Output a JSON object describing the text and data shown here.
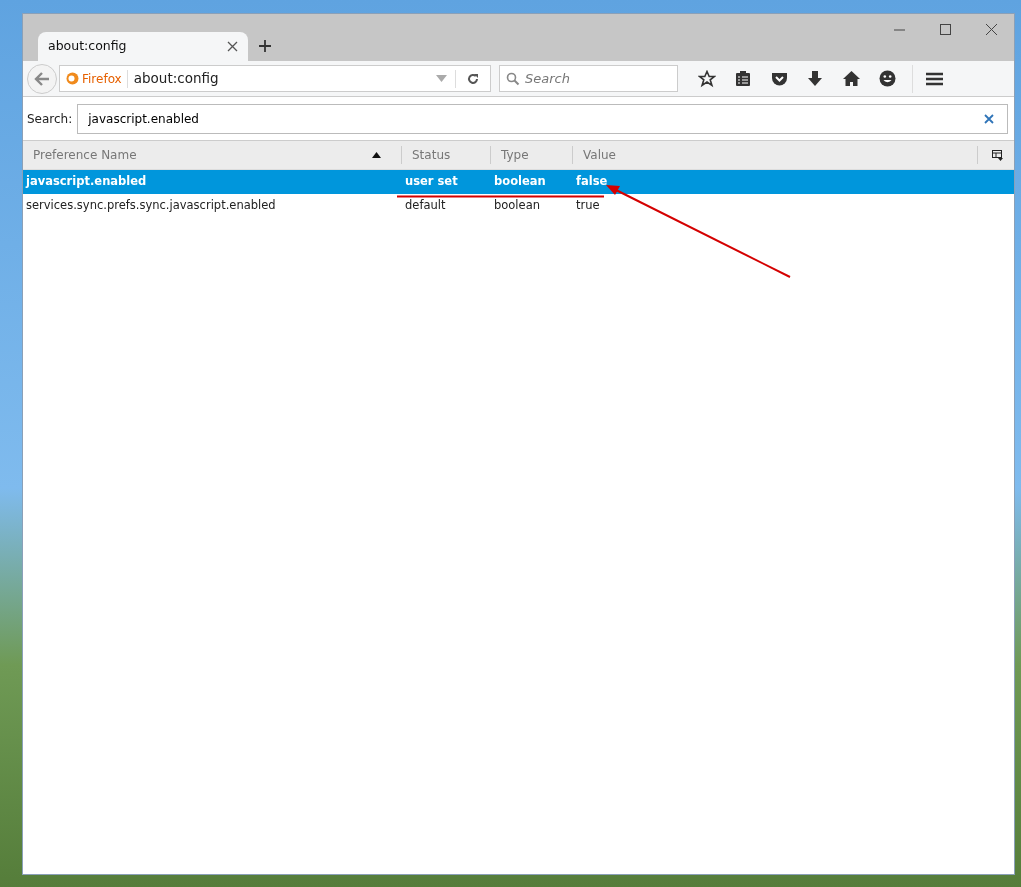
{
  "tabs": [
    {
      "label": "about:config",
      "selected": true
    }
  ],
  "nav": {
    "identity": "Firefox",
    "url": "about:config",
    "search_placeholder": "Search"
  },
  "filter": {
    "label": "Search:",
    "value": "javascript.enabled"
  },
  "table": {
    "columns": [
      {
        "label": "Preference Name",
        "sorted": true
      },
      {
        "label": "Status",
        "sorted": false
      },
      {
        "label": "Type",
        "sorted": false
      },
      {
        "label": "Value",
        "sorted": false
      }
    ],
    "rows": [
      {
        "name": "javascript.enabled",
        "status": "user set",
        "type": "boolean",
        "value": "false",
        "modified": true,
        "selected": true
      },
      {
        "name": "services.sync.prefs.sync.javascript.enabled",
        "status": "default",
        "type": "boolean",
        "value": "true",
        "modified": false,
        "selected": false
      }
    ]
  }
}
